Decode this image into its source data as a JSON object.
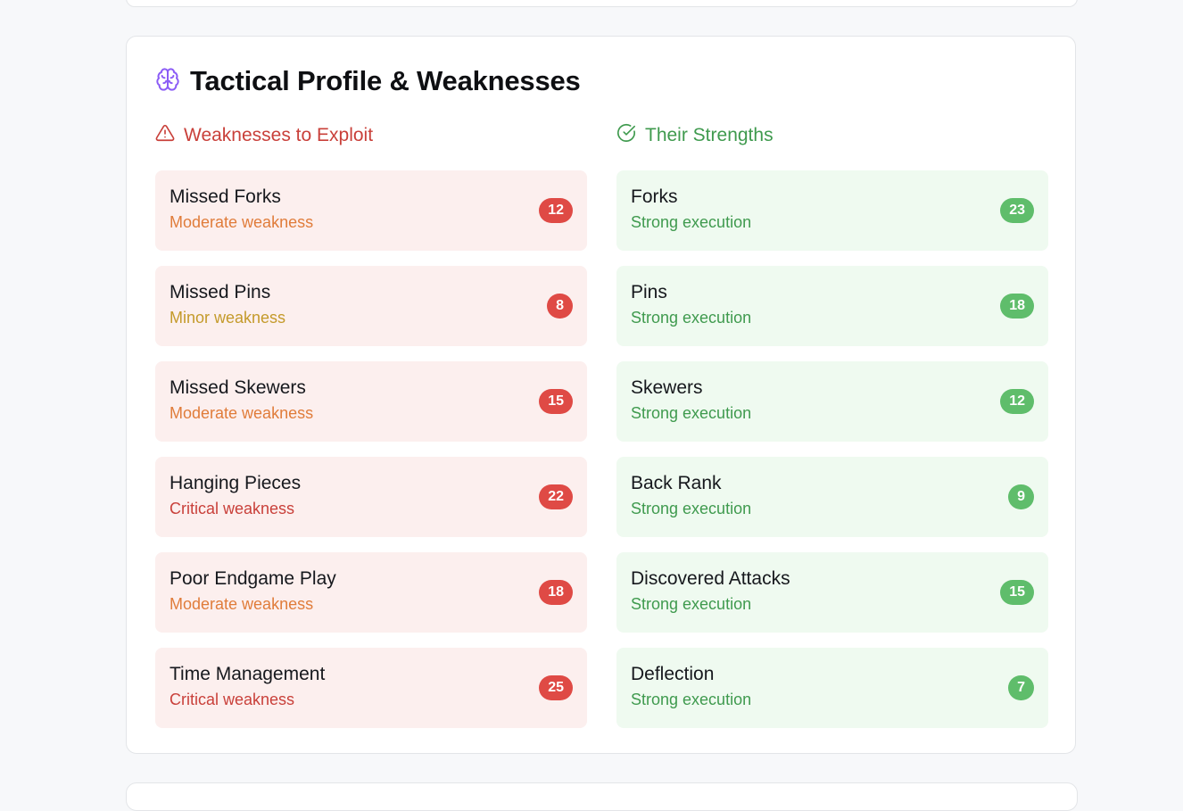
{
  "colors": {
    "accent_purple": "#8b5cf6",
    "weakness_red": "#c9403a",
    "weakness_orange": "#e07c3a",
    "weakness_amber": "#c49a2a",
    "strength_green": "#3f9a4e",
    "badge_red": "#df4a45",
    "badge_green": "#5fbd6b"
  },
  "card": {
    "title": "Tactical Profile & Weaknesses",
    "icon": "brain-icon"
  },
  "weaknesses": {
    "heading": "Weaknesses to Exploit",
    "icon": "warning-triangle-icon",
    "items": [
      {
        "name": "Missed Forks",
        "severity": "Moderate weakness",
        "count": "12",
        "color": "#e07c3a"
      },
      {
        "name": "Missed Pins",
        "severity": "Minor weakness",
        "count": "8",
        "color": "#c49a2a"
      },
      {
        "name": "Missed Skewers",
        "severity": "Moderate weakness",
        "count": "15",
        "color": "#e07c3a"
      },
      {
        "name": "Hanging Pieces",
        "severity": "Critical weakness",
        "count": "22",
        "color": "#c9403a"
      },
      {
        "name": "Poor Endgame Play",
        "severity": "Moderate weakness",
        "count": "18",
        "color": "#e07c3a"
      },
      {
        "name": "Time Management",
        "severity": "Critical weakness",
        "count": "25",
        "color": "#c9403a"
      }
    ]
  },
  "strengths": {
    "heading": "Their Strengths",
    "icon": "check-circle-icon",
    "items": [
      {
        "name": "Forks",
        "severity": "Strong execution",
        "count": "23",
        "color": "#3f9a4e"
      },
      {
        "name": "Pins",
        "severity": "Strong execution",
        "count": "18",
        "color": "#3f9a4e"
      },
      {
        "name": "Skewers",
        "severity": "Strong execution",
        "count": "12",
        "color": "#3f9a4e"
      },
      {
        "name": "Back Rank",
        "severity": "Strong execution",
        "count": "9",
        "color": "#3f9a4e"
      },
      {
        "name": "Discovered Attacks",
        "severity": "Strong execution",
        "count": "15",
        "color": "#3f9a4e"
      },
      {
        "name": "Deflection",
        "severity": "Strong execution",
        "count": "7",
        "color": "#3f9a4e"
      }
    ]
  }
}
